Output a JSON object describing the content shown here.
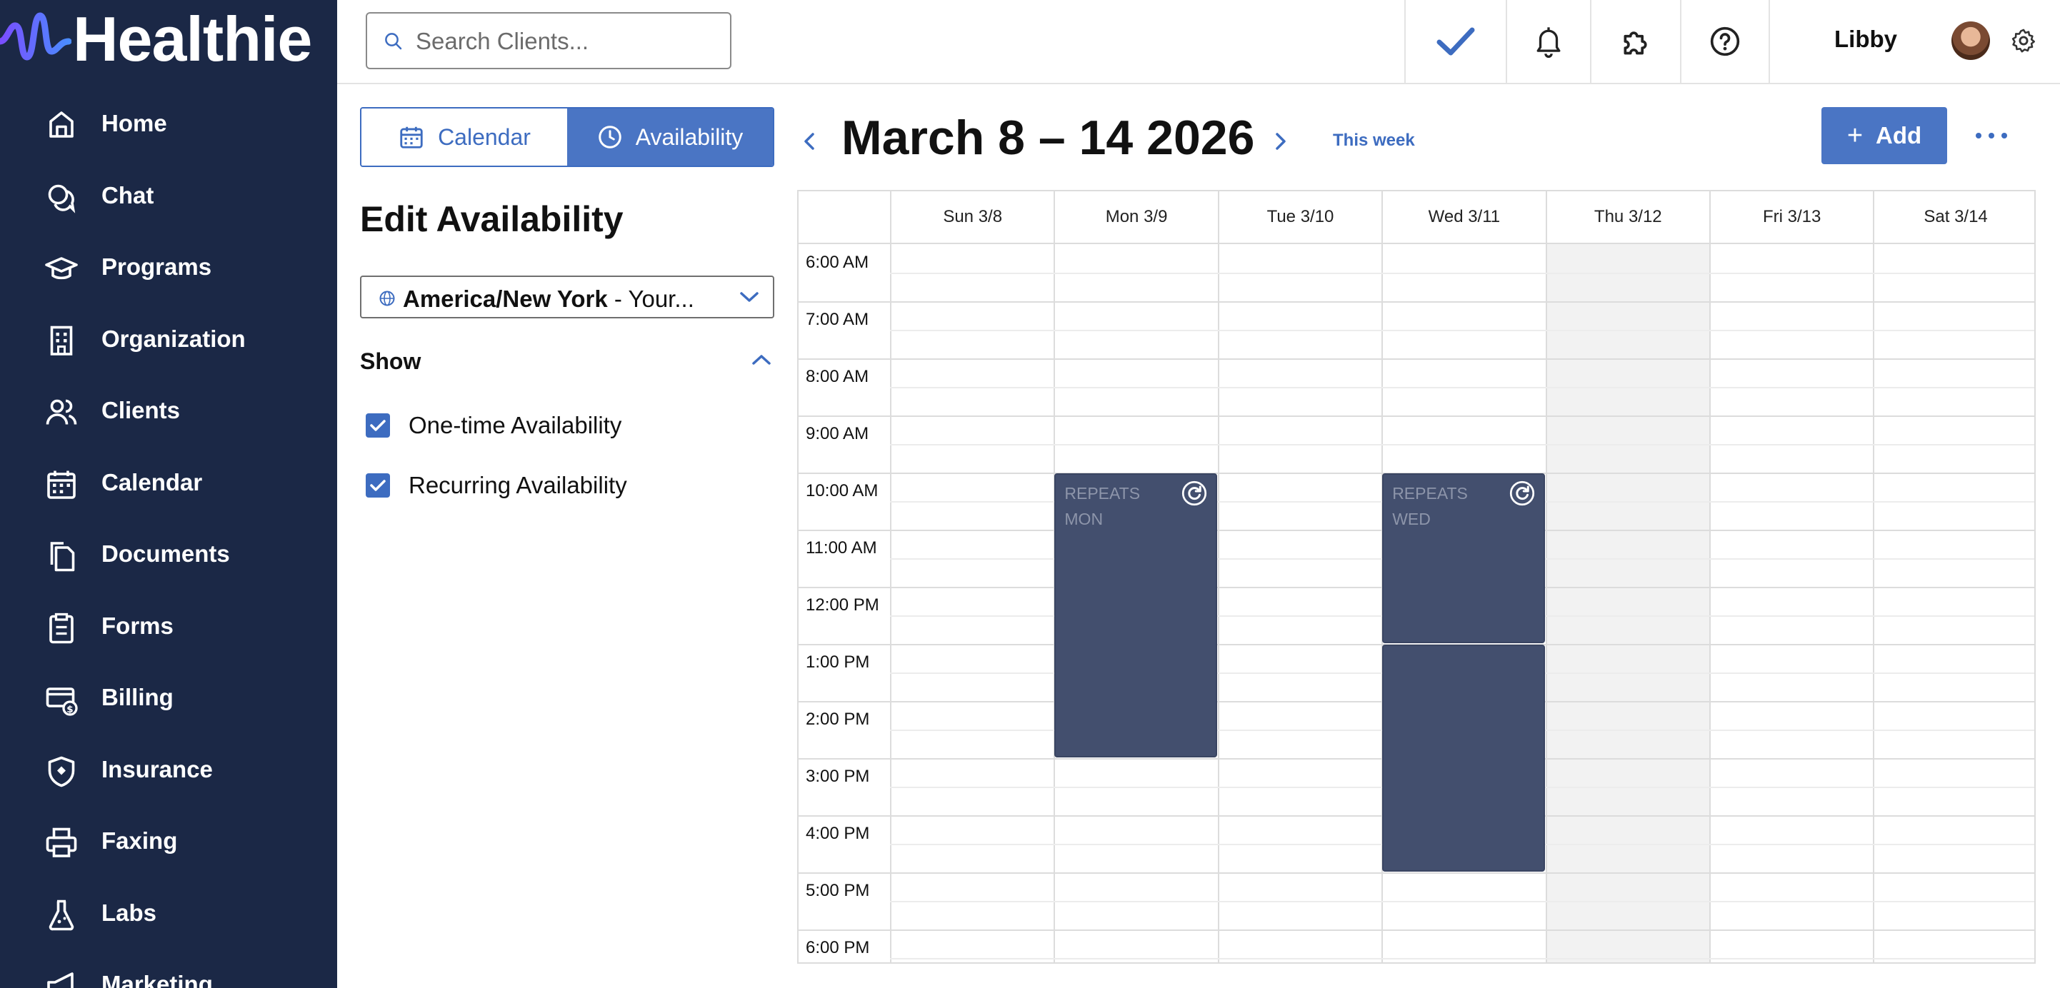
{
  "app": {
    "brand": "Healthie",
    "brand_color": "#1b2846",
    "accent_color": "#3d6cc0"
  },
  "sidebar": {
    "items": [
      {
        "label": "Home",
        "icon": "home-icon"
      },
      {
        "label": "Chat",
        "icon": "chat-icon"
      },
      {
        "label": "Programs",
        "icon": "graduation-cap-icon"
      },
      {
        "label": "Organization",
        "icon": "building-icon"
      },
      {
        "label": "Clients",
        "icon": "users-icon"
      },
      {
        "label": "Calendar",
        "icon": "calendar-icon"
      },
      {
        "label": "Documents",
        "icon": "documents-icon"
      },
      {
        "label": "Forms",
        "icon": "clipboard-icon"
      },
      {
        "label": "Billing",
        "icon": "billing-icon"
      },
      {
        "label": "Insurance",
        "icon": "shield-icon"
      },
      {
        "label": "Faxing",
        "icon": "printer-icon"
      },
      {
        "label": "Labs",
        "icon": "flask-icon"
      },
      {
        "label": "Marketing",
        "icon": "megaphone-icon"
      }
    ]
  },
  "topbar": {
    "search_placeholder": "Search Clients...",
    "user_name": "Libby"
  },
  "view_toggle": {
    "calendar_label": "Calendar",
    "availability_label": "Availability",
    "active": "Availability"
  },
  "panel": {
    "title": "Edit Availability",
    "timezone": {
      "name": "America/New York",
      "suffix": " - Your..."
    },
    "show_label": "Show",
    "filters": [
      {
        "label": "One-time Availability",
        "checked": true
      },
      {
        "label": "Recurring Availability",
        "checked": true
      }
    ]
  },
  "calendar": {
    "range_title": "March 8 – 14 2026",
    "this_week_label": "This week",
    "add_label": "Add",
    "days": [
      "Sun 3/8",
      "Mon 3/9",
      "Tue 3/10",
      "Wed 3/11",
      "Thu 3/12",
      "Fri 3/13",
      "Sat 3/14"
    ],
    "shaded_day": "Thu 3/12",
    "hours": [
      "6:00 AM",
      "7:00 AM",
      "8:00 AM",
      "9:00 AM",
      "10:00 AM",
      "11:00 AM",
      "12:00 PM",
      "1:00 PM",
      "2:00 PM",
      "3:00 PM",
      "4:00 PM",
      "5:00 PM",
      "6:00 PM"
    ],
    "events": [
      {
        "day": "Mon 3/9",
        "start": "10:00 AM",
        "end": "2:55 PM",
        "line1": "REPEATS",
        "line2": "MON",
        "recurring": true
      },
      {
        "day": "Wed 3/11",
        "start": "10:00 AM",
        "end": "12:55 PM",
        "line1": "REPEATS",
        "line2": "WED",
        "recurring": true
      },
      {
        "day": "Wed 3/11",
        "start": "1:00 PM",
        "end": "4:55 PM",
        "line1": "",
        "line2": "",
        "recurring": false
      }
    ],
    "event_color": "#434f6e"
  }
}
